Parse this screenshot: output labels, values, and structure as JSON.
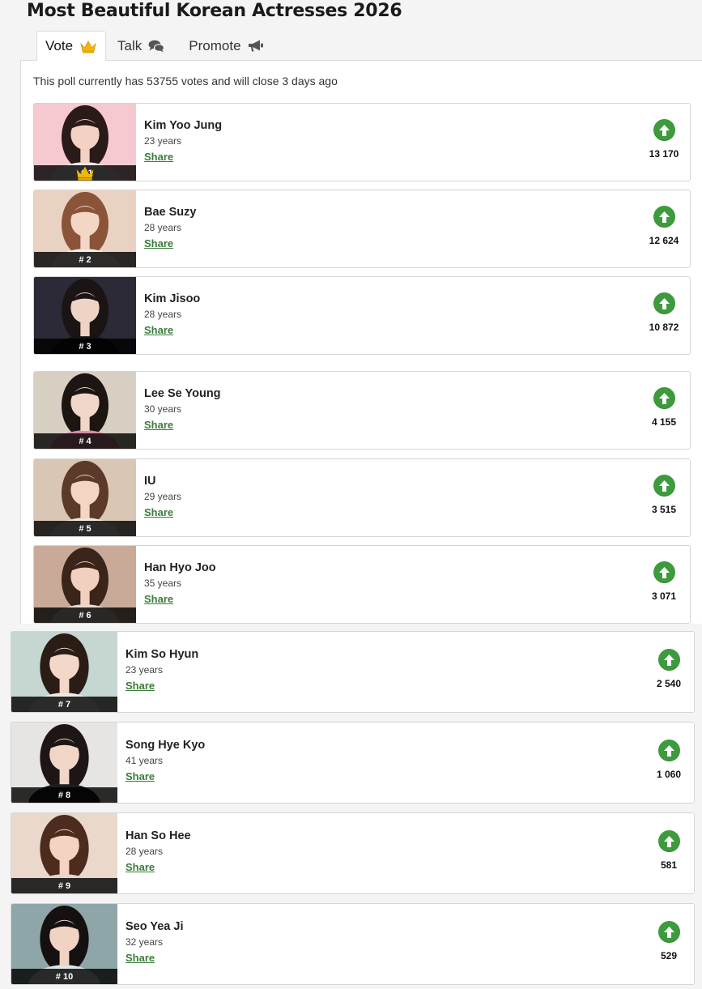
{
  "page": {
    "title": "Most Beautiful Korean Actresses 2026",
    "poll_info": "This poll currently has 53755 votes and will close 3 days ago"
  },
  "tabs": [
    {
      "label": "Vote",
      "icon": "crown-icon"
    },
    {
      "label": "Talk",
      "icon": "chat-bubbles-icon"
    },
    {
      "label": "Promote",
      "icon": "megaphone-icon"
    }
  ],
  "colors": {
    "vote_green": "#3d9b3d",
    "share_green": "#3a7d3a",
    "crown_gold": "#f2b705"
  },
  "share_label": "Share",
  "entries": [
    {
      "rank": "# 1",
      "name": "Kim Yoo Jung",
      "age": "23 years",
      "votes": "13 170",
      "crown": true
    },
    {
      "rank": "# 2",
      "name": "Bae Suzy",
      "age": "28 years",
      "votes": "12 624"
    },
    {
      "rank": "# 3",
      "name": "Kim Jisoo",
      "age": "28 years",
      "votes": "10 872"
    },
    {
      "rank": "# 4",
      "name": "Lee Se Young",
      "age": "30 years",
      "votes": "4 155"
    },
    {
      "rank": "# 5",
      "name": "IU",
      "age": "29 years",
      "votes": "3 515"
    },
    {
      "rank": "# 6",
      "name": "Han Hyo Joo",
      "age": "35 years",
      "votes": "3 071"
    },
    {
      "rank": "# 7",
      "name": "Kim So Hyun",
      "age": "23 years",
      "votes": "2 540"
    },
    {
      "rank": "# 8",
      "name": "Song Hye Kyo",
      "age": "41 years",
      "votes": "1 060"
    },
    {
      "rank": "# 9",
      "name": "Han So Hee",
      "age": "28 years",
      "votes": "581"
    },
    {
      "rank": "# 10",
      "name": "Seo Yea Ji",
      "age": "32 years",
      "votes": "529"
    }
  ]
}
